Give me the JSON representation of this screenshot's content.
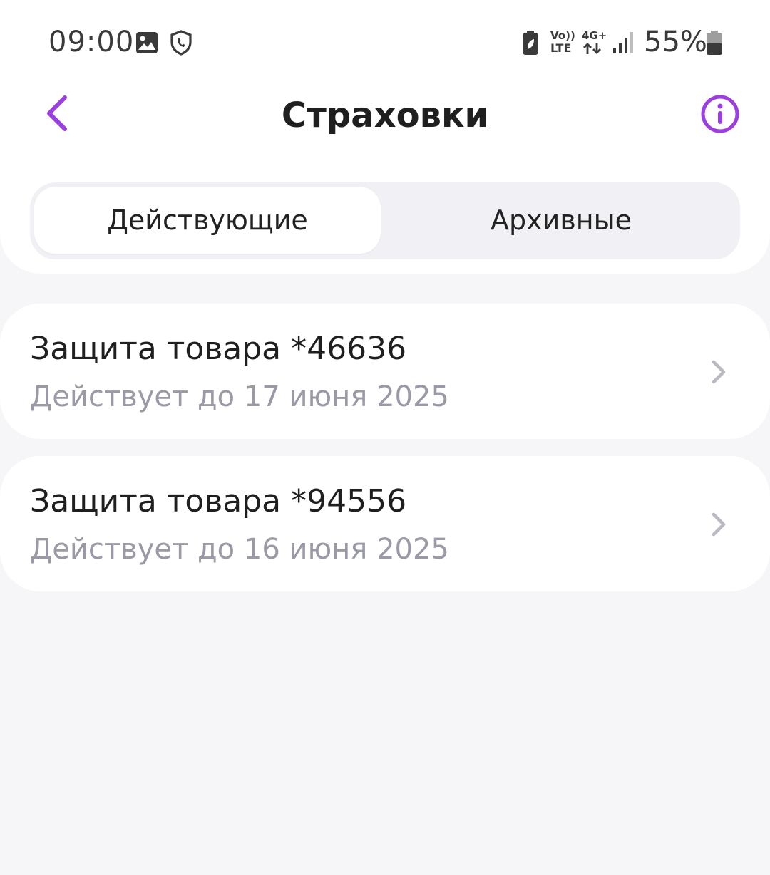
{
  "status_bar": {
    "time": "09:00",
    "battery_percent": "55%",
    "icons": [
      "image-icon",
      "shield-phone-icon",
      "battery-saver-icon",
      "volte-icon",
      "4g-plus-icon",
      "signal-icon",
      "battery-icon"
    ],
    "volte_label_top": "Vo))",
    "volte_label_bottom": "LTE",
    "network_label": "4G+"
  },
  "header": {
    "title": "Страховки",
    "back_icon": "chevron-left-icon",
    "info_icon": "info-icon",
    "accent_color": "#9b3fe0"
  },
  "tabs": [
    {
      "label": "Действующие",
      "active": true
    },
    {
      "label": "Архивные",
      "active": false
    }
  ],
  "policies": [
    {
      "title": "Защита товара *46636",
      "subtitle": "Действует до 17 июня 2025"
    },
    {
      "title": "Защита товара *94556",
      "subtitle": "Действует до 16 июня 2025"
    }
  ]
}
